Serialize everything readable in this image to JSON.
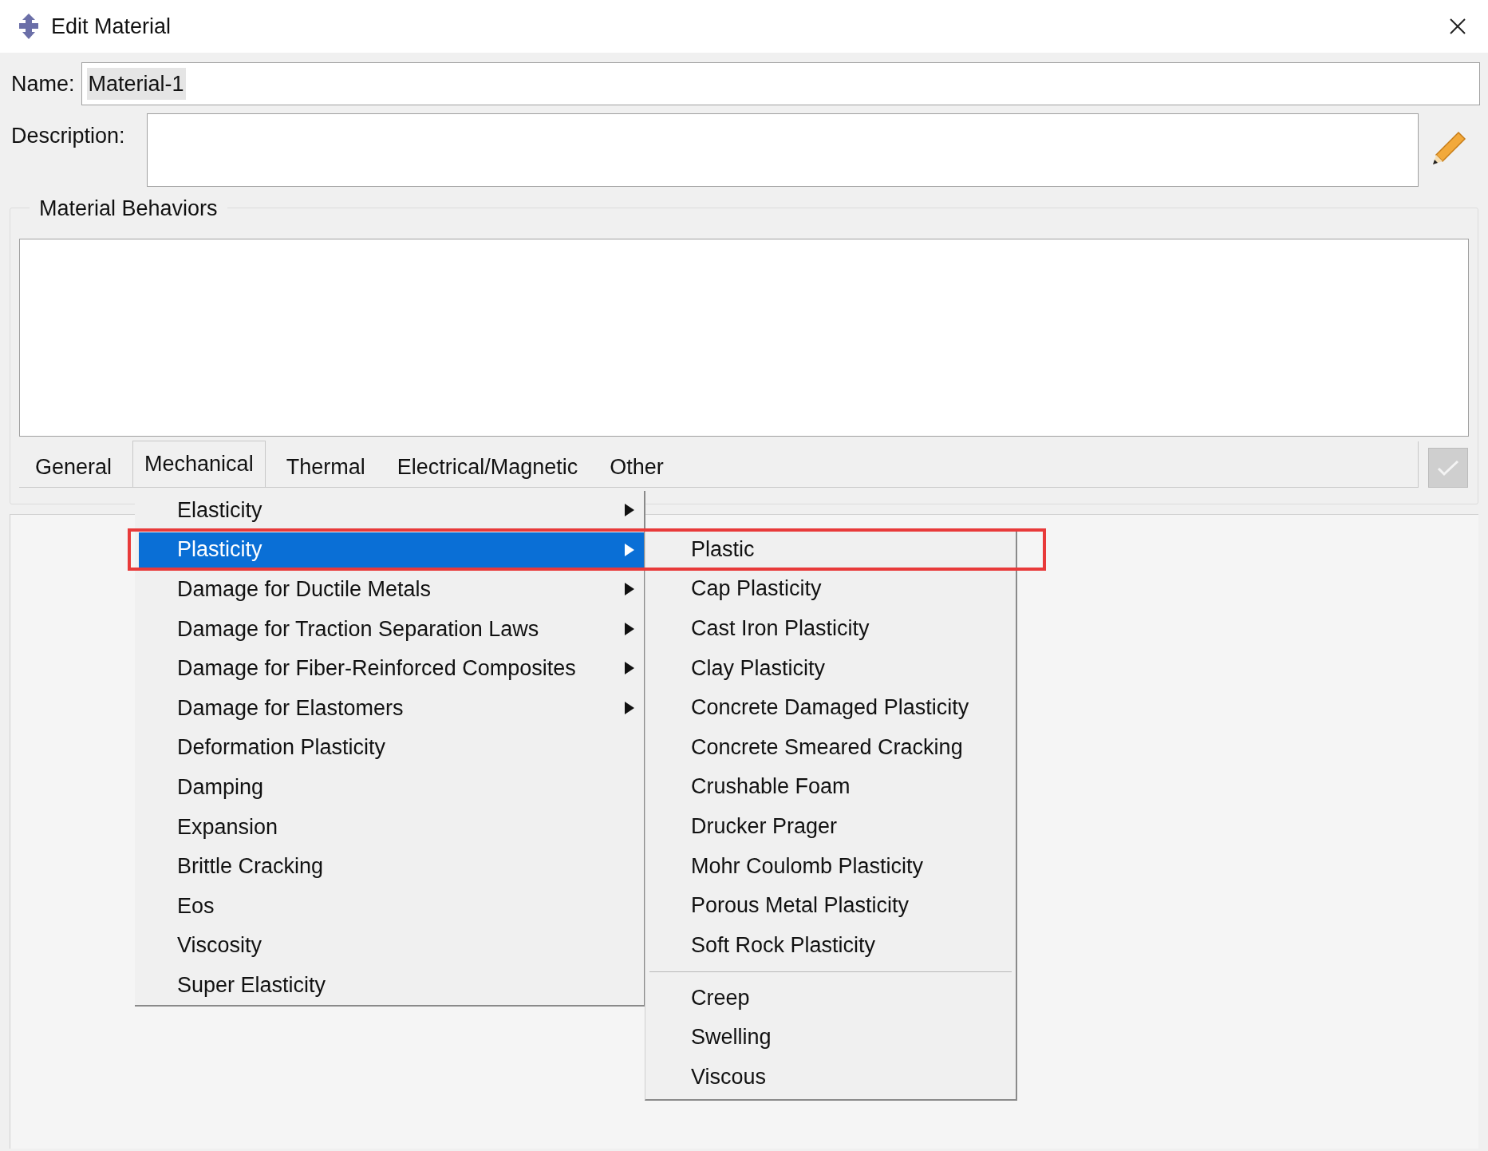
{
  "window": {
    "title": "Edit Material"
  },
  "name": {
    "label": "Name:",
    "value": "Material-1"
  },
  "description": {
    "label": "Description:"
  },
  "material_behaviors": {
    "title": "Material Behaviors"
  },
  "tabs": [
    {
      "label": "General",
      "selected": false
    },
    {
      "label": "Mechanical",
      "selected": true
    },
    {
      "label": "Thermal",
      "selected": false
    },
    {
      "label": "Electrical/Magnetic",
      "selected": false
    },
    {
      "label": "Other",
      "selected": false
    }
  ],
  "apply_button": {
    "disabled": true
  },
  "menu": {
    "items": [
      {
        "label": "Elasticity",
        "has_submenu": true,
        "selected": false
      },
      {
        "label": "Plasticity",
        "has_submenu": true,
        "selected": true
      },
      {
        "label": "Damage for Ductile Metals",
        "has_submenu": true,
        "selected": false
      },
      {
        "label": "Damage for Traction Separation Laws",
        "has_submenu": true,
        "selected": false
      },
      {
        "label": "Damage for Fiber-Reinforced Composites",
        "has_submenu": true,
        "selected": false
      },
      {
        "label": "Damage for Elastomers",
        "has_submenu": true,
        "selected": false
      },
      {
        "label": "Deformation Plasticity",
        "has_submenu": false,
        "selected": false
      },
      {
        "label": "Damping",
        "has_submenu": false,
        "selected": false
      },
      {
        "label": "Expansion",
        "has_submenu": false,
        "selected": false
      },
      {
        "label": "Brittle Cracking",
        "has_submenu": false,
        "selected": false
      },
      {
        "label": "Eos",
        "has_submenu": false,
        "selected": false
      },
      {
        "label": "Viscosity",
        "has_submenu": false,
        "selected": false
      },
      {
        "label": "Super Elasticity",
        "has_submenu": false,
        "selected": false
      }
    ]
  },
  "submenu": {
    "items": [
      {
        "kind": "item",
        "label": "Plastic"
      },
      {
        "kind": "item",
        "label": "Cap Plasticity"
      },
      {
        "kind": "item",
        "label": "Cast Iron Plasticity"
      },
      {
        "kind": "item",
        "label": "Clay Plasticity"
      },
      {
        "kind": "item",
        "label": "Concrete Damaged Plasticity"
      },
      {
        "kind": "item",
        "label": "Concrete Smeared Cracking"
      },
      {
        "kind": "item",
        "label": "Crushable Foam"
      },
      {
        "kind": "item",
        "label": "Drucker Prager"
      },
      {
        "kind": "item",
        "label": "Mohr Coulomb Plasticity"
      },
      {
        "kind": "item",
        "label": "Porous Metal Plasticity"
      },
      {
        "kind": "item",
        "label": "Soft Rock Plasticity"
      },
      {
        "kind": "separator"
      },
      {
        "kind": "item",
        "label": "Creep"
      },
      {
        "kind": "item",
        "label": "Swelling"
      },
      {
        "kind": "item",
        "label": "Viscous"
      }
    ]
  }
}
